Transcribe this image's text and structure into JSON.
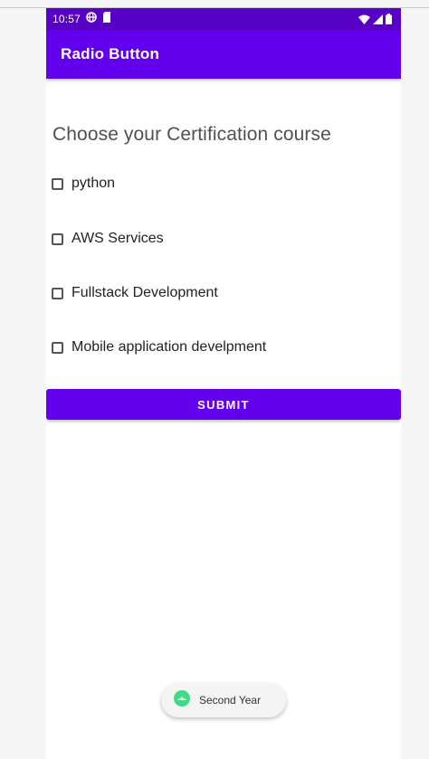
{
  "status_bar": {
    "time": "10:57",
    "icons": [
      "globe-icon",
      "sd-card-icon",
      "wifi-icon",
      "signal-icon",
      "battery-icon"
    ]
  },
  "app_bar": {
    "title": "Radio Button"
  },
  "main": {
    "heading": "Choose your Certification course",
    "options": [
      {
        "label": "python",
        "checked": false
      },
      {
        "label": "AWS Services",
        "checked": false
      },
      {
        "label": "Fullstack Development",
        "checked": false
      },
      {
        "label": "Mobile application develpment",
        "checked": false
      }
    ],
    "submit_label": "SUBMIT"
  },
  "toast": {
    "text": "Second Year",
    "icon": "android-icon"
  },
  "colors": {
    "primary": "#6200ee",
    "primary_dark": "#5700c6",
    "toast_icon": "#3ddc84"
  }
}
